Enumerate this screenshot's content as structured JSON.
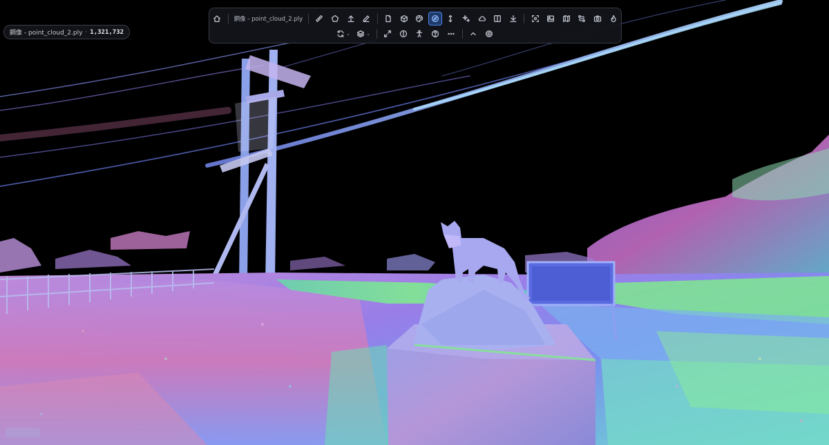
{
  "badge": {
    "label": "鋼像 - point_cloud_2.ply",
    "separator": "·",
    "point_count": "1,321,732"
  },
  "toolbar": {
    "file_label": "鋼像 - point_cloud_2.ply",
    "row1": [
      {
        "icon": "home-icon",
        "name": "home-button"
      },
      {
        "icon": "ruler-icon",
        "name": "measure-distance-button"
      },
      {
        "icon": "pentagon-icon",
        "name": "polygon-tool-button"
      },
      {
        "icon": "upload-icon",
        "name": "upload-button"
      },
      {
        "icon": "pencil-icon",
        "name": "annotate-button"
      },
      {
        "icon": "file-icon",
        "name": "document-button"
      },
      {
        "icon": "cube-icon",
        "name": "cube-view-button"
      },
      {
        "icon": "palette-icon",
        "name": "color-button"
      },
      {
        "icon": "compass-icon",
        "name": "navigation-button",
        "active": true
      },
      {
        "icon": "vertical-arrows-icon",
        "name": "height-button"
      },
      {
        "icon": "sparkles-icon",
        "name": "effects-button"
      },
      {
        "icon": "cloud-icon",
        "name": "cloud-button"
      },
      {
        "icon": "split-view-icon",
        "name": "split-view-button"
      },
      {
        "icon": "download-icon",
        "name": "download-button"
      },
      {
        "icon": "focus-icon",
        "name": "focus-button"
      },
      {
        "icon": "image-icon",
        "name": "image-button"
      },
      {
        "icon": "map-icon",
        "name": "map-button"
      },
      {
        "icon": "route-icon",
        "name": "route-button"
      },
      {
        "icon": "camera-icon",
        "name": "camera-button"
      },
      {
        "icon": "flame-icon",
        "name": "heatmap-button"
      }
    ],
    "row2": [
      {
        "icon": "rotate-icon",
        "name": "rotate-mode-button",
        "caret": true
      },
      {
        "icon": "layers-icon",
        "name": "layers-button",
        "caret": true
      },
      {
        "icon": "expand-icon",
        "name": "fullscreen-button"
      },
      {
        "icon": "info-icon",
        "name": "info-button"
      },
      {
        "icon": "person-icon",
        "name": "walk-mode-button"
      },
      {
        "icon": "help-icon",
        "name": "help-button"
      },
      {
        "icon": "more-icon",
        "name": "more-button"
      },
      {
        "icon": "chevron-up-icon",
        "name": "collapse-toolbar-button"
      },
      {
        "icon": "settings-icon",
        "name": "settings-button"
      }
    ]
  },
  "colors": {
    "toolbar_bg": "#12141a",
    "active_accent": "#4d86e6",
    "sky": "#000000"
  }
}
